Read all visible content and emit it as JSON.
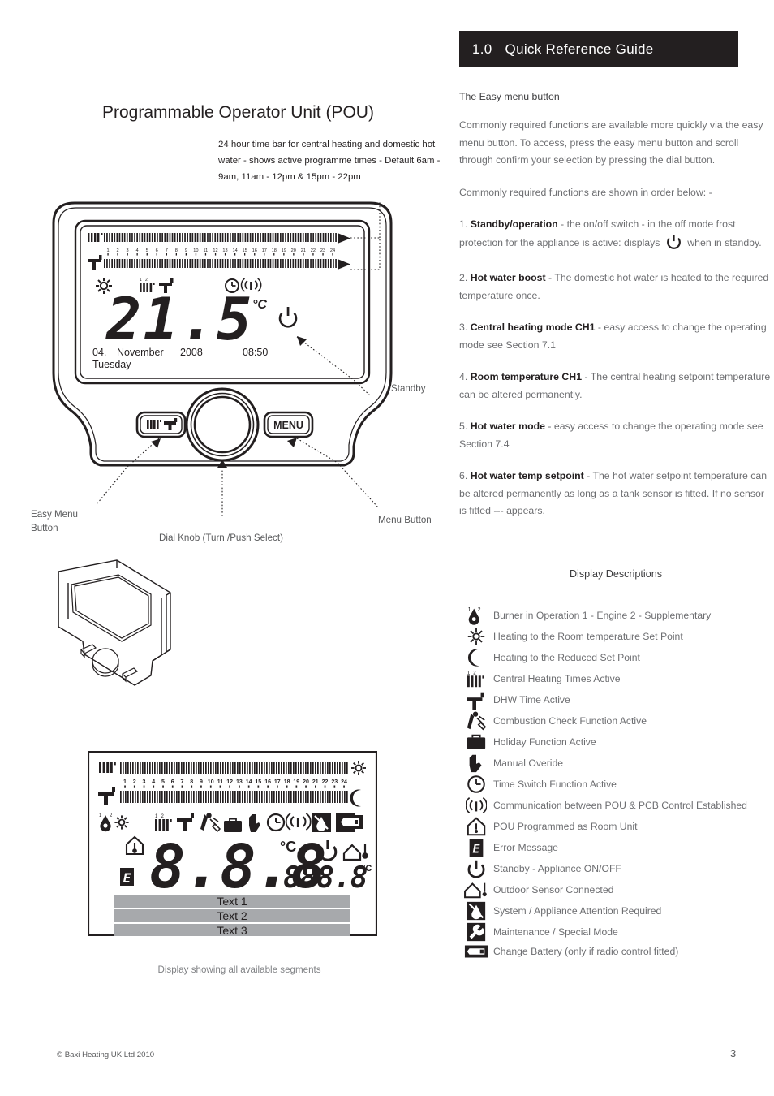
{
  "header": {
    "number": "1.0",
    "title": "Quick Reference Guide"
  },
  "left": {
    "doc_title": "Programmable Operator Unit (POU)",
    "timebar_note": "24 hour time bar for central heating and domestic hot water - shows active programme times - Default 6am - 9am, 11am - 12pm & 15pm - 22pm",
    "callouts": {
      "easy_menu": "Easy Menu Button",
      "dial_knob": "Dial Knob (Turn /Push Select)",
      "menu_button": "Menu Button",
      "standby": "Standby"
    },
    "lcd": {
      "temperature": "21.5",
      "unit": "°C",
      "day_number": "04.",
      "month": "November",
      "year": "2008",
      "time": "08:50",
      "weekday": "Tuesday",
      "hours": [
        "1",
        "2",
        "3",
        "4",
        "5",
        "6",
        "7",
        "8",
        "9",
        "10",
        "11",
        "12",
        "13",
        "14",
        "15",
        "16",
        "17",
        "18",
        "19",
        "20",
        "21",
        "22",
        "23",
        "24"
      ]
    },
    "segment_display": {
      "caption": "Display showing all available segments",
      "digits_main": "8.8.8",
      "digits_small": "888.8",
      "unit_main": "°C",
      "unit_small": "°C",
      "error_letter": "E",
      "text_rows": [
        "Text 1",
        "Text 2",
        "Text 3"
      ],
      "hours": [
        "1",
        "2",
        "3",
        "4",
        "5",
        "6",
        "7",
        "8",
        "9",
        "10",
        "11",
        "12",
        "13",
        "14",
        "15",
        "16",
        "17",
        "18",
        "19",
        "20",
        "21",
        "22",
        "23",
        "24"
      ]
    },
    "buttons": {
      "menu_label": "MENU"
    }
  },
  "right": {
    "subhead": "The Easy menu button",
    "paragraphs": [
      "Commonly required functions are available more quickly via the easy menu button. To access, press the easy menu button and scroll through confirm your selection by pressing the dial button.",
      "Commonly required functions are shown in order below: -"
    ],
    "items": [
      {
        "num": "1. ",
        "bold": "Standby/operation",
        "rest_a": " - the on/off switch - in the off mode frost protection for the appliance is active: displays ",
        "icon": "power-icon",
        "rest_b": " when in standby."
      },
      {
        "num": "2. ",
        "bold": "Hot water boost",
        "rest_a": " - The domestic hot water is heated to the required temperature once.",
        "icon": "",
        "rest_b": ""
      },
      {
        "num": "3. ",
        "bold": "Central heating mode CH1",
        "rest_a": " - easy access to change the operating mode see Section 7.1",
        "icon": "",
        "rest_b": ""
      },
      {
        "num": "4. ",
        "bold": "Room temperature CH1",
        "rest_a": " - The central heating setpoint temperature can be altered permanently.",
        "icon": "",
        "rest_b": ""
      },
      {
        "num": "5. ",
        "bold": "Hot water mode",
        "rest_a": " -  easy access to change the operating mode see Section 7.4",
        "icon": "",
        "rest_b": ""
      },
      {
        "num": "6. ",
        "bold": "Hot water temp setpoint",
        "rest_a": " - The hot water setpoint temperature can be altered permanently as long as a tank sensor is fitted. If no sensor is fitted --- appears.",
        "icon": "",
        "rest_b": ""
      }
    ],
    "descriptions_title": "Display Descriptions",
    "descriptions": [
      {
        "icon": "burner-flame-icon",
        "label": "Burner in Operation 1 - Engine 2 - Supplementary"
      },
      {
        "icon": "sun-icon",
        "label": "Heating to the Room temperature Set Point"
      },
      {
        "icon": "moon-icon",
        "label": "Heating to the Reduced Set Point"
      },
      {
        "icon": "radiator-icon",
        "label": "Central Heating Times Active"
      },
      {
        "icon": "tap-icon",
        "label": "DHW Time Active"
      },
      {
        "icon": "chimney-sweep-icon",
        "label": "Combustion Check Function Active"
      },
      {
        "icon": "suitcase-icon",
        "label": "Holiday Function Active"
      },
      {
        "icon": "hand-icon",
        "label": "Manual Overide"
      },
      {
        "icon": "clock-icon",
        "label": "Time Switch Function Active"
      },
      {
        "icon": "antenna-icon",
        "label": "Communication between POU & PCB Control Established"
      },
      {
        "icon": "house-thermometer-icon",
        "label": "POU Programmed as Room Unit"
      },
      {
        "icon": "error-e-icon",
        "label": "Error Message"
      },
      {
        "icon": "power-icon",
        "label": "Standby - Appliance ON/OFF"
      },
      {
        "icon": "outdoor-sensor-icon",
        "label": "Outdoor Sensor Connected"
      },
      {
        "icon": "attention-icon",
        "label": "System / Appliance Attention Required"
      },
      {
        "icon": "spanner-icon",
        "label": "Maintenance / Special Mode"
      },
      {
        "icon": "battery-icon",
        "label": "Change Battery (only if radio control fitted)"
      }
    ]
  },
  "footer": {
    "copyright": "© Baxi Heating UK Ltd 2010",
    "page": "3"
  },
  "colors": {
    "header_bg": "#231f20",
    "body_text": "#6d6e71",
    "bold_text": "#231f20",
    "lcd_grey": "#a7a9ac"
  }
}
